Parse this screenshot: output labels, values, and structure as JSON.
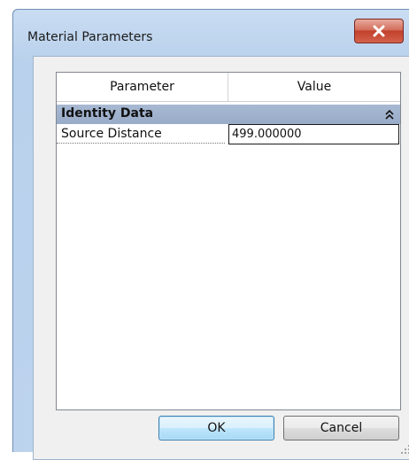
{
  "window": {
    "title": "Material Parameters",
    "close_icon": "close-icon",
    "close_color": "#c2412c"
  },
  "grid": {
    "columns": [
      "Parameter",
      "Value"
    ],
    "group": {
      "title": "Identity Data",
      "collapse_icon": "double-chevron-up-icon"
    },
    "rows": [
      {
        "label": "Source Distance",
        "value": "499.000000"
      }
    ],
    "group_color": "#a8b9d2"
  },
  "buttons": {
    "ok_label": "OK",
    "cancel_label": "Cancel"
  },
  "resize_grip_icon": "resize-grip-icon"
}
